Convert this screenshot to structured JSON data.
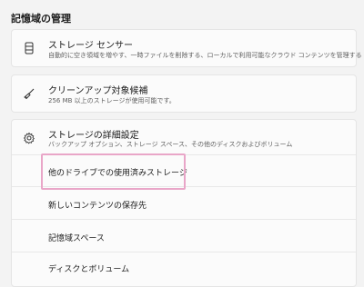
{
  "section": {
    "title": "記憶域の管理"
  },
  "storage_sense": {
    "title": "ストレージ センサー",
    "description": "自動的に空き領域を増やす、一時ファイルを削除する、ローカルで利用可能なクラウド コンテンツを管理する",
    "icon": "storage-drive-icon"
  },
  "cleanup": {
    "title": "クリーンアップ対象候補",
    "description": "256 MB 以上のストレージが使用可能です。",
    "icon": "broom-icon"
  },
  "advanced": {
    "title": "ストレージの詳細設定",
    "description": "バックアップ オプション、ストレージ スペース、その他のディスクおよびボリューム",
    "icon": "gear-icon",
    "items": [
      {
        "label": "他のドライブでの使用済みストレージ"
      },
      {
        "label": "新しいコンテンツの保存先"
      },
      {
        "label": "記憶域スペース"
      },
      {
        "label": "ディスクとボリューム"
      }
    ]
  },
  "colors": {
    "highlight": "#e9a6c8",
    "background": "#f3f3f3",
    "card": "#fbfbfb"
  }
}
